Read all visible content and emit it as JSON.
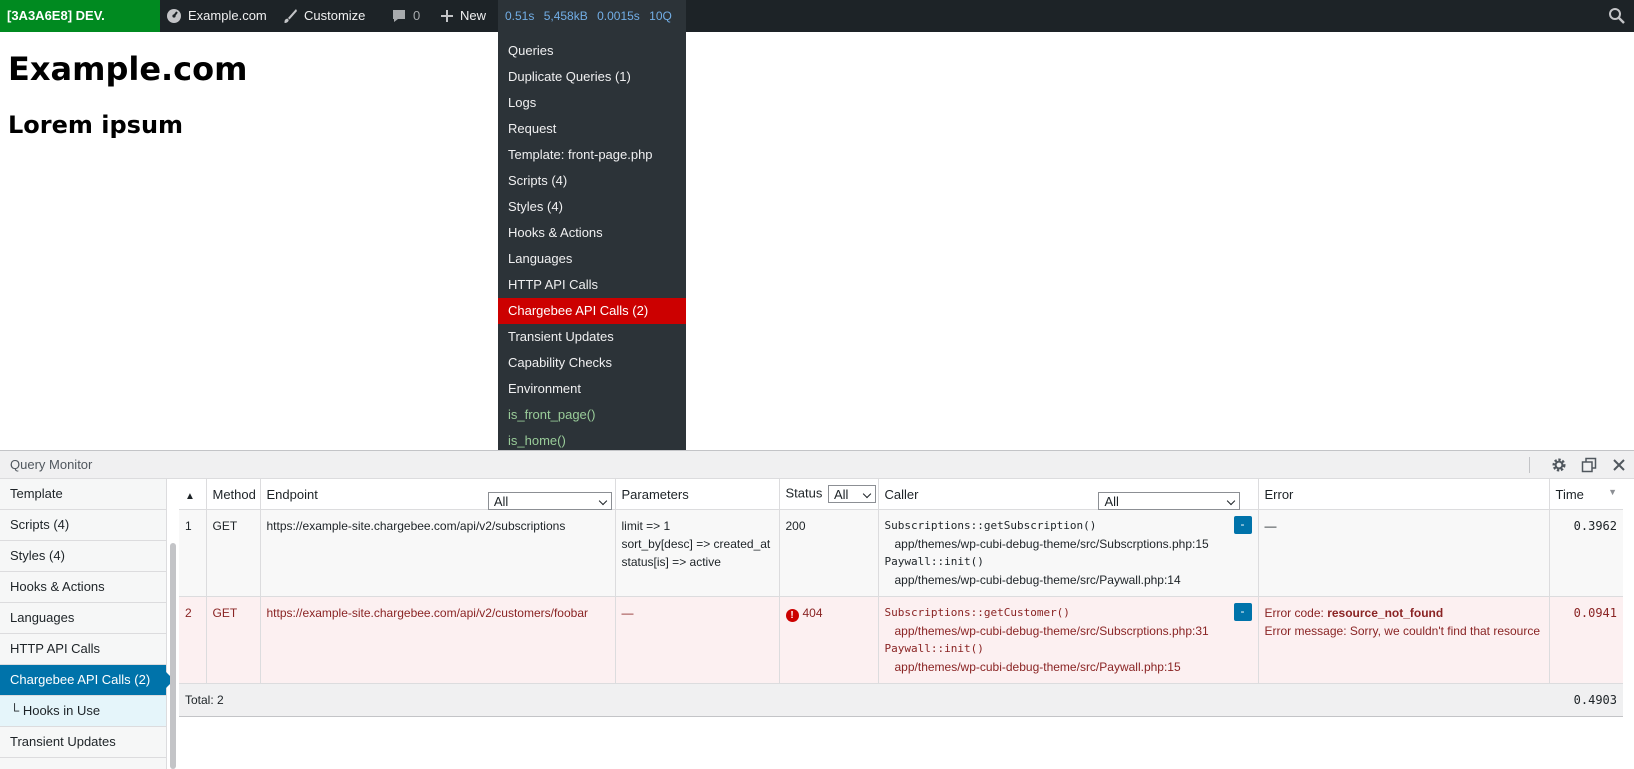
{
  "adminbar": {
    "env_label": "[3A3A6E8] DEV.",
    "site_name": "Example.com",
    "customize": "Customize",
    "comments_count": "0",
    "new": "New",
    "qm_stats": [
      "0.51s",
      "5,458kB",
      "0.0015s",
      "10Q"
    ]
  },
  "qm_menu": {
    "items": [
      {
        "label": "Queries"
      },
      {
        "label": "Duplicate Queries (1)"
      },
      {
        "label": "Logs"
      },
      {
        "label": "Request"
      },
      {
        "label": "Template: front-page.php"
      },
      {
        "label": "Scripts (4)"
      },
      {
        "label": "Styles (4)"
      },
      {
        "label": "Hooks & Actions"
      },
      {
        "label": "Languages"
      },
      {
        "label": "HTTP API Calls"
      },
      {
        "label": "Chargebee API Calls (2)"
      },
      {
        "label": "Transient Updates"
      },
      {
        "label": "Capability Checks"
      },
      {
        "label": "Environment"
      },
      {
        "label": "is_front_page()"
      },
      {
        "label": "is_home()"
      }
    ]
  },
  "page": {
    "title": "Example.com",
    "subtitle": "Lorem ipsum"
  },
  "qm_panel": {
    "title": "Query Monitor",
    "nav": [
      {
        "label": "Template"
      },
      {
        "label": "Scripts (4)"
      },
      {
        "label": "Styles (4)"
      },
      {
        "label": "Hooks & Actions"
      },
      {
        "label": "Languages"
      },
      {
        "label": "HTTP API Calls"
      },
      {
        "label": "Chargebee API Calls (2)"
      },
      {
        "label": "└ Hooks in Use"
      },
      {
        "label": "Transient Updates"
      }
    ],
    "table": {
      "headers": {
        "method": "Method",
        "endpoint": "Endpoint",
        "endpoint_filter": "All",
        "parameters": "Parameters",
        "status": "Status",
        "status_filter": "All",
        "caller": "Caller",
        "caller_filter": "All",
        "error": "Error",
        "time": "Time"
      },
      "rows": [
        {
          "num": "1",
          "method": "GET",
          "endpoint": "https://example-site.chargebee.com/api/v2/subscriptions",
          "params": [
            "limit => 1",
            "sort_by[desc] => created_at",
            "status[is] => active"
          ],
          "status": "200",
          "caller_1": "Subscriptions::getSubscription()",
          "caller_1_path": "app/themes/wp-cubi-debug-theme/src/Subscrptions.php:15",
          "caller_2": "Paywall::init()",
          "caller_2_path": "app/themes/wp-cubi-debug-theme/src/Paywall.php:14",
          "toggle": "-",
          "error": "—",
          "time": "0.3962"
        },
        {
          "num": "2",
          "method": "GET",
          "endpoint": "https://example-site.chargebee.com/api/v2/customers/foobar",
          "params_text": "—",
          "status_icon": "!",
          "status": "404",
          "caller_1": "Subscriptions::getCustomer()",
          "caller_1_path": "app/themes/wp-cubi-debug-theme/src/Subscrptions.php:31",
          "caller_2": "Paywall::init()",
          "caller_2_path": "app/themes/wp-cubi-debug-theme/src/Paywall.php:15",
          "toggle": "-",
          "error_code_label": "Error code:",
          "error_code": "resource_not_found",
          "error_message": "Error message: Sorry, we couldn't find that resource",
          "time": "0.0941"
        }
      ],
      "total_label": "Total: 2",
      "total_time": "0.4903"
    }
  },
  "colors": {
    "adminbar_bg": "#1d2327",
    "env_bg": "#008a20",
    "active_menu": "#cc0000",
    "active_nav": "#0073aa",
    "stats_text": "#72aee6",
    "error_row_bg": "#fcf0f1"
  }
}
